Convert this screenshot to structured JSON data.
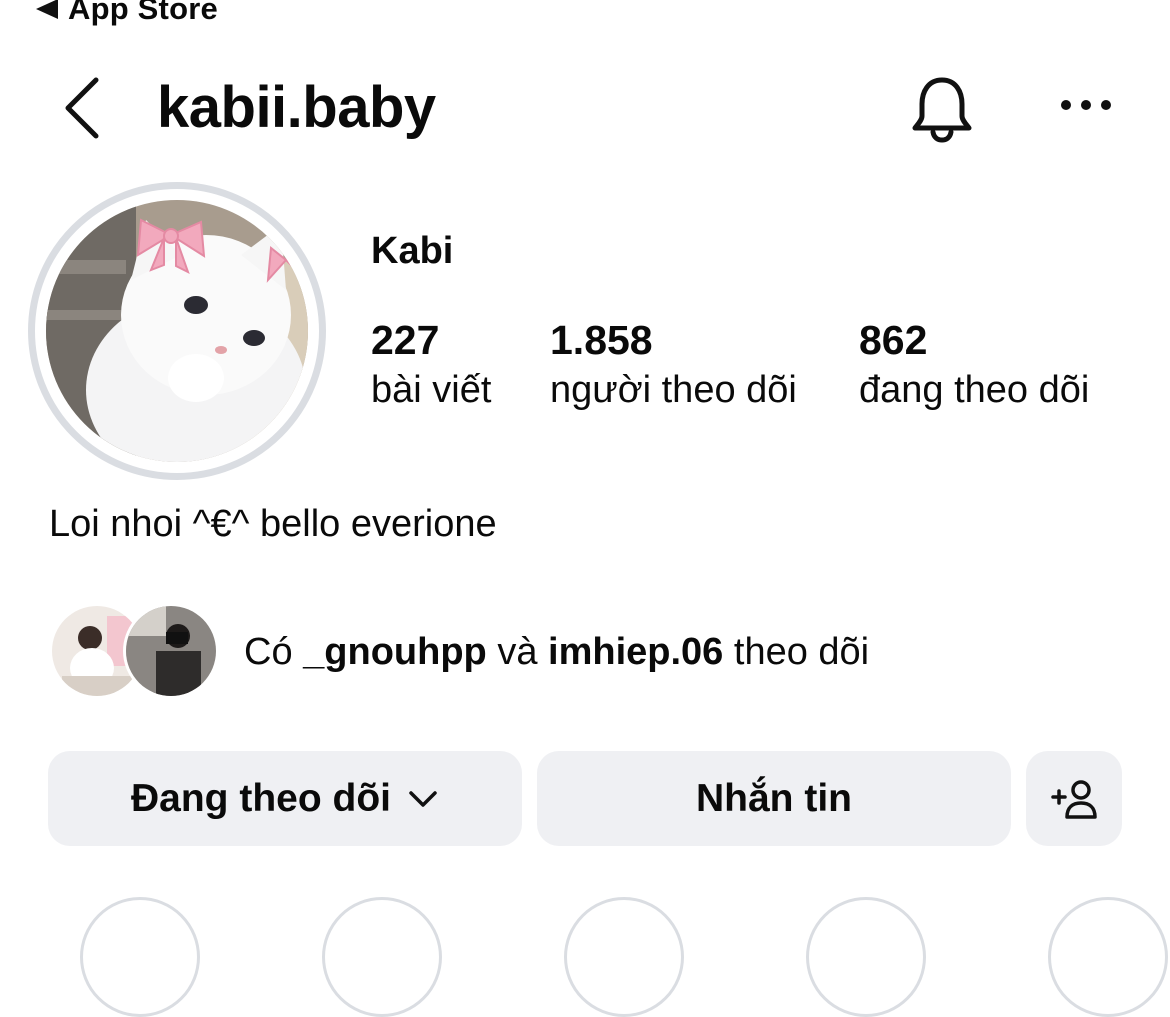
{
  "status_bar": {
    "back_app_label": "App Store"
  },
  "header": {
    "username": "kabii.baby"
  },
  "profile": {
    "display_name": "Kabi",
    "stats": [
      {
        "value": "227",
        "label": "bài viết"
      },
      {
        "value": "1.858",
        "label": "người theo dõi"
      },
      {
        "value": "862",
        "label": "đang theo dõi"
      }
    ],
    "bio": "Loi nhoi ^€^ bello everione"
  },
  "followed_by": {
    "prefix": "Có",
    "user1": "_gnouhpp",
    "conjunction": "và",
    "user2": "imhiep.06",
    "suffix": "theo dõi"
  },
  "actions": {
    "following_label": "Đang theo dõi",
    "message_label": "Nhắn tin"
  },
  "icons": {
    "back": "chevron-left-icon",
    "notifications": "bell-icon",
    "more": "more-horizontal-icon",
    "dropdown": "chevron-down-icon",
    "add_person": "add-person-icon"
  },
  "colors": {
    "button_bg": "#eff0f3",
    "avatar_ring": "#dadde2",
    "text": "#0a0a0a"
  }
}
